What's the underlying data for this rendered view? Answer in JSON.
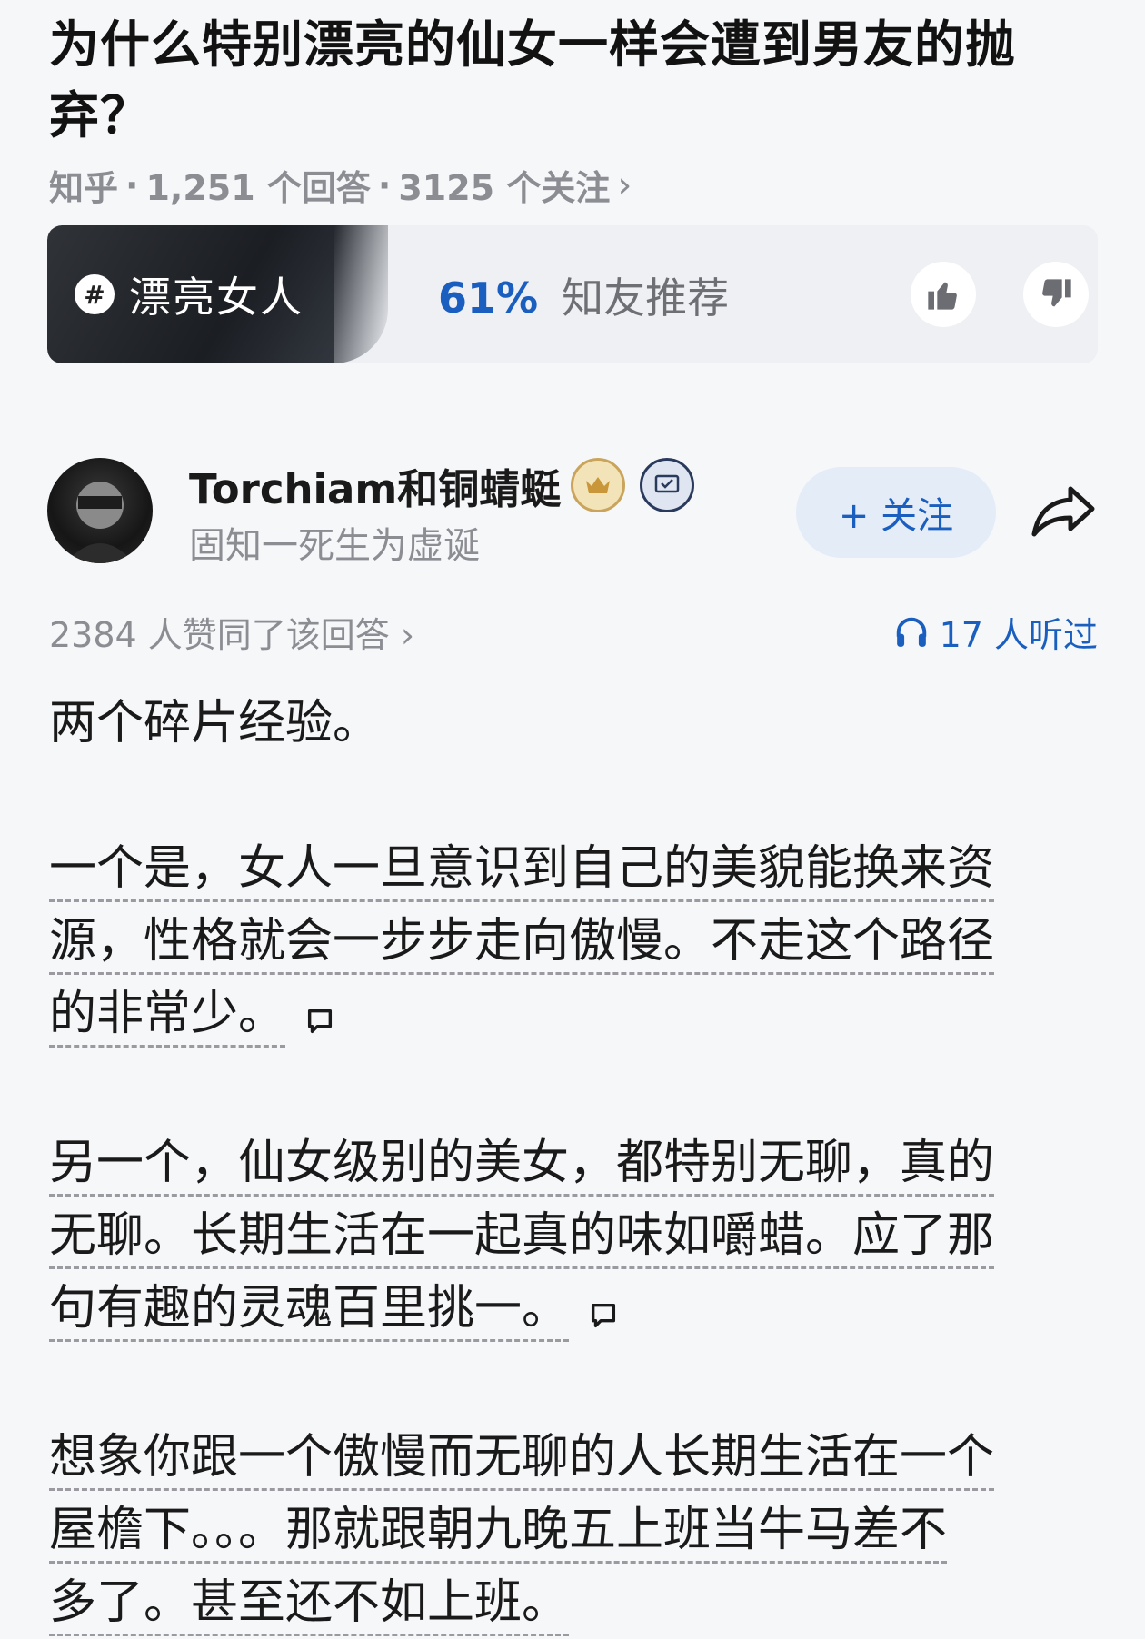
{
  "question": {
    "title": "为什么特别漂亮的仙女一样会遭到男友的抛弃？",
    "meta": [
      "知乎",
      "·",
      "1,251 个回答",
      "·",
      "3125 个关注",
      "›"
    ]
  },
  "topic_card": {
    "topic_icon": "#",
    "topic": "漂亮女人",
    "recommend_pct": "61%",
    "recommend_text": "知友推荐",
    "thumb_up_icon": "thumbs-up-icon",
    "thumb_down_icon": "thumbs-down-icon"
  },
  "author": {
    "name": "Torchiam和铜蜻蜓",
    "signature": "固知一死生为虚诞",
    "follow_label": "+ 关注",
    "badges": [
      "crown-badge-icon",
      "verified-badge-icon"
    ]
  },
  "answer_meta": {
    "votes": "2384 人赞同了该回答 ›",
    "listen": "17 人听过"
  },
  "answer": {
    "p1": "两个碎片经验。",
    "p2_lines": [
      "一个是，女人一旦意识到自己的美貌能换来资",
      "源，性格就会一步步走向傲慢。不走这个路径",
      "的非常少。"
    ],
    "p3_lines": [
      "另一个，仙女级别的美女，都特别无聊，真的",
      "无聊。长期生活在一起真的味如嚼蜡。应了那",
      "句有趣的灵魂百里挑一。"
    ],
    "p4_lines": [
      "想象你跟一个傲慢而无聊的人长期生活在一个",
      "屋檐下。。。那就跟朝九晚五上班当牛马差不",
      "多了。甚至还不如上班。"
    ]
  },
  "colors": {
    "accent": "#1a5fbf",
    "muted": "#8c8c93",
    "background": "#f6f7f9"
  }
}
